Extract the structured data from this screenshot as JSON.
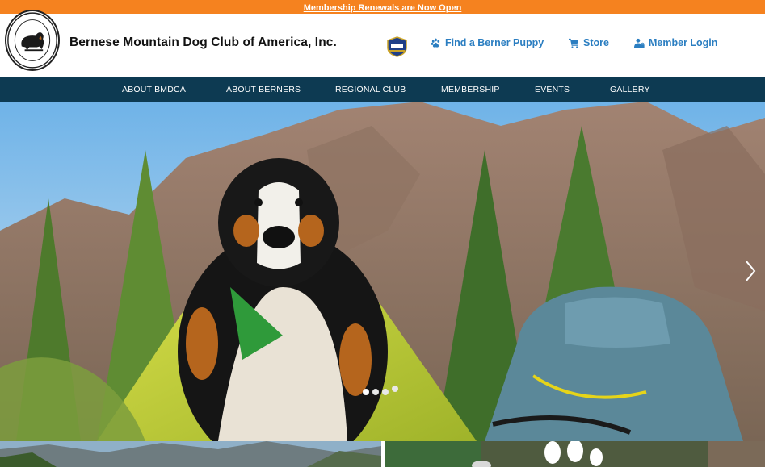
{
  "banner": {
    "text": "Membership Renewals are Now Open"
  },
  "header": {
    "logo_ring_text": "BERNESE MOUNTAIN DOG CLUB OF AMERICA, INC.",
    "title": "Bernese Mountain Dog Club of America, Inc.",
    "links": [
      {
        "label": "Find a Berner Puppy",
        "icon": "paw-icon"
      },
      {
        "label": "Store",
        "icon": "cart-icon"
      },
      {
        "label": "Member Login",
        "icon": "user-lock-icon"
      }
    ]
  },
  "nav": {
    "items": [
      "ABOUT BMDCA",
      "ABOUT BERNERS",
      "REGIONAL CLUB",
      "MEMBERSHIP",
      "EVENTS",
      "GALLERY"
    ]
  },
  "hero": {
    "slide_count": 4,
    "active_slide": 1
  },
  "colors": {
    "banner": "#f5821f",
    "nav": "#0d3a52",
    "link": "#2b7ec1"
  }
}
